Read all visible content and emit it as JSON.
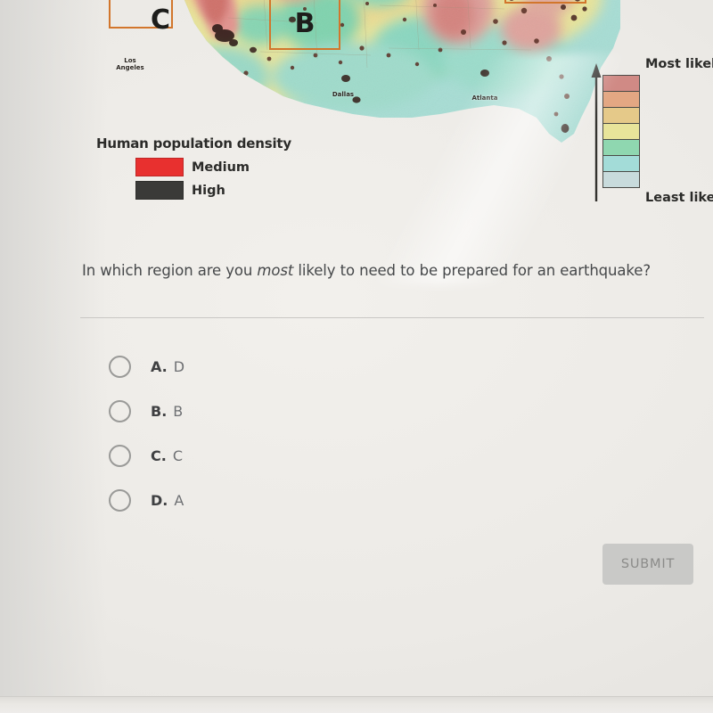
{
  "map": {
    "regions": [
      {
        "id": "c",
        "label": "C"
      },
      {
        "id": "b",
        "label": "B"
      },
      {
        "id": "d",
        "label": ""
      }
    ],
    "cities": [
      {
        "name": "Los\nAngeles"
      },
      {
        "name": "Dallas"
      },
      {
        "name": "Atlanta"
      }
    ],
    "legend": {
      "title": "Human population density",
      "entries": [
        {
          "label": "Medium",
          "color": "#e8302f"
        },
        {
          "label": "High",
          "color": "#3a3a38"
        }
      ]
    },
    "scale": {
      "top_caption": "Most likely",
      "bottom_caption": "Least likely",
      "bands": [
        "#d08a85",
        "#e3a783",
        "#e5c989",
        "#e8e49a",
        "#8fd7b0",
        "#a3dcd8",
        "#c8dbdc"
      ]
    }
  },
  "question": {
    "prefix": "In which region are you ",
    "emphasis": "most",
    "suffix": " likely to need to be prepared for an earthquake?"
  },
  "options": [
    {
      "letter": "A.",
      "value": "D"
    },
    {
      "letter": "B.",
      "value": "B"
    },
    {
      "letter": "C.",
      "value": "C"
    },
    {
      "letter": "D.",
      "value": "A"
    }
  ],
  "submit": {
    "label": "SUBMIT"
  }
}
